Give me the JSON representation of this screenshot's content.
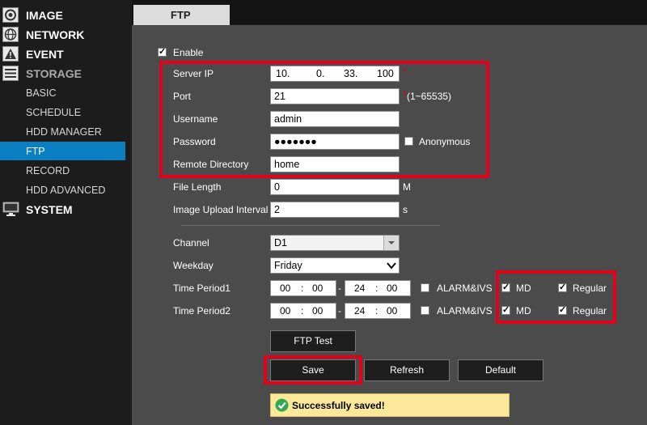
{
  "sidebar": {
    "categories": {
      "image": "IMAGE",
      "network": "NETWORK",
      "event": "EVENT",
      "storage": "STORAGE",
      "system": "SYSTEM"
    },
    "storage_items": [
      "BASIC",
      "SCHEDULE",
      "HDD MANAGER",
      "FTP",
      "RECORD",
      "HDD ADVANCED"
    ]
  },
  "tab": {
    "label": "FTP"
  },
  "form": {
    "enable_label": "Enable",
    "enable_checked": true,
    "server_ip": {
      "label": "Server IP",
      "octets": [
        "10.",
        "0.",
        "33.",
        "100"
      ]
    },
    "port": {
      "label": "Port",
      "value": "21",
      "range": "(1~65535)"
    },
    "username": {
      "label": "Username",
      "value": "admin"
    },
    "password": {
      "label": "Password",
      "value": "●●●●●●●",
      "anonymous_label": "Anonymous"
    },
    "remote_directory": {
      "label": "Remote Directory",
      "value": "home"
    },
    "file_length": {
      "label": "File Length",
      "value": "0",
      "unit": "M"
    },
    "upload_interval": {
      "label": "Image Upload Interval",
      "value": "2",
      "unit": "s"
    },
    "channel": {
      "label": "Channel",
      "value": "D1"
    },
    "weekday": {
      "label": "Weekday",
      "value": "Friday"
    },
    "time_periods": [
      {
        "label": "Time Period1",
        "start_h": "00",
        "start_m": "00",
        "end_h": "24",
        "end_m": "00",
        "alarm": "ALARM&IVS",
        "md": "MD",
        "regular": "Regular"
      },
      {
        "label": "Time Period2",
        "start_h": "00",
        "start_m": "00",
        "end_h": "24",
        "end_m": "00",
        "alarm": "ALARM&IVS",
        "md": "MD",
        "regular": "Regular"
      }
    ]
  },
  "buttons": {
    "ftp_test": "FTP Test",
    "save": "Save",
    "refresh": "Refresh",
    "default": "Default"
  },
  "status": {
    "message": "Successfully saved!"
  },
  "colors": {
    "highlight_red": "#e3001b",
    "active_blue": "#0a7fc2",
    "success_bg": "#fbe89a",
    "success_green": "#34a853"
  }
}
